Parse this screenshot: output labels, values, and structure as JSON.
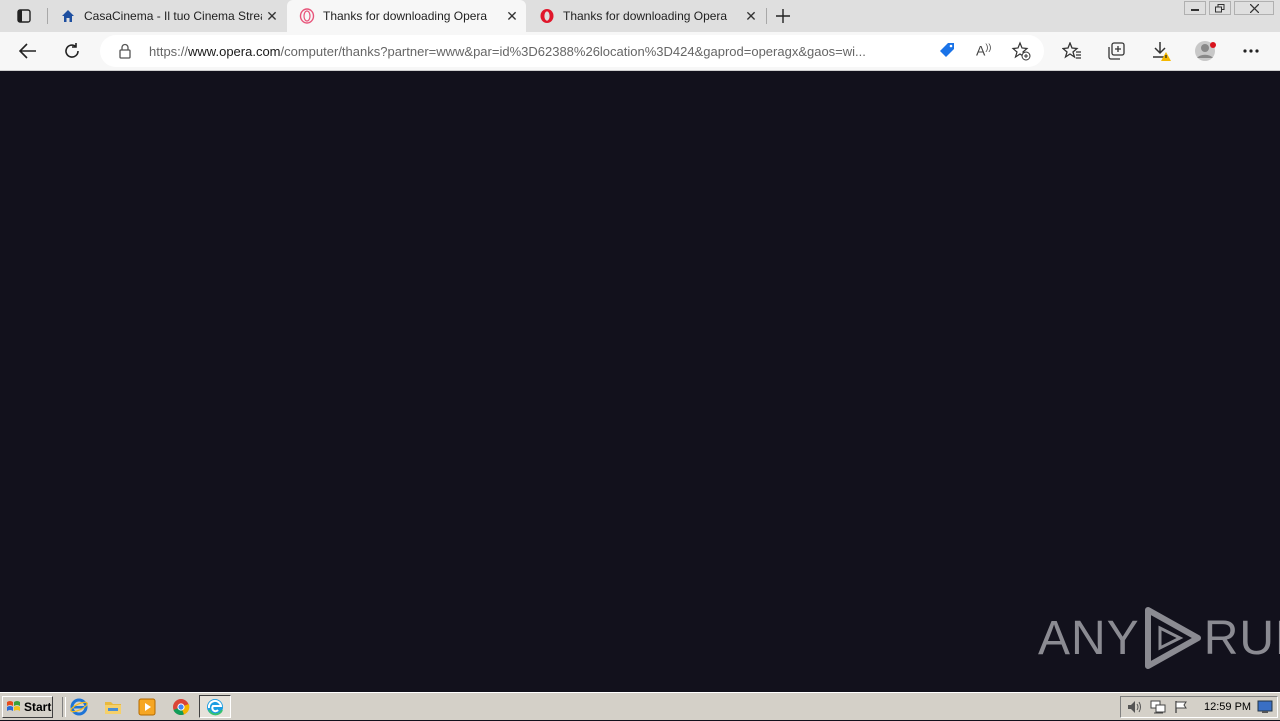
{
  "tabs": [
    {
      "title": "CasaCinema - Il tuo Cinema Streaming",
      "icon": "home-icon"
    },
    {
      "title": "Thanks for downloading Opera",
      "icon": "opera-gx-icon",
      "active": true
    },
    {
      "title": "Thanks for downloading Opera",
      "icon": "opera-icon"
    }
  ],
  "address": {
    "scheme": "https://",
    "domain": "www.opera.com",
    "path": "/computer/thanks?partner=www&par=id%3D62388%26location%3D424&gaprod=operagx&gaos=wi..."
  },
  "watermark": {
    "left": "ANY",
    "right": "RUN"
  },
  "taskbar": {
    "start_label": "Start",
    "clock": "12:59 PM"
  },
  "colors": {
    "page_bg": "#12111c",
    "tabbar_bg": "#dfdfdf",
    "taskbar_bg": "#d4d0c8"
  }
}
